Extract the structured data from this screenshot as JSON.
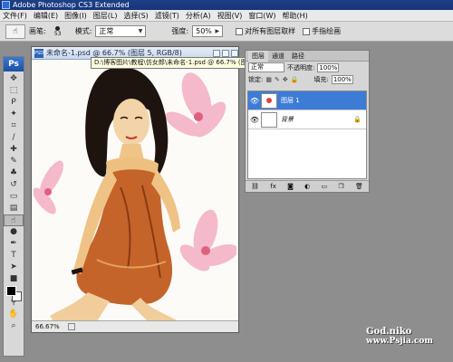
{
  "title_bar": {
    "title": "Adobe Photoshop CS3 Extended"
  },
  "menu": [
    "文件(F)",
    "编辑(E)",
    "图像(I)",
    "图层(L)",
    "选择(S)",
    "滤镜(T)",
    "分析(A)",
    "视图(V)",
    "窗口(W)",
    "帮助(H)"
  ],
  "options": {
    "brush_label": "画笔:",
    "brush_size": "53",
    "mode_label": "模式:",
    "mode_value": "正常",
    "strength_label": "强度:",
    "strength_value": "50%",
    "sample_all_layers": "对所有图层取样",
    "finger_painting": "手指绘画"
  },
  "document": {
    "title": "未命名-1.psd @ 66.7% (图层 5, RGB/8)",
    "zoom": "66.67%",
    "tooltip": "D:\\博客图片\\教程\\仿女郎\\未命名-1.psd @ 66.7% (图层 5, RGB/8)"
  },
  "layers_panel": {
    "tabs": [
      "图层",
      "通道",
      "路径"
    ],
    "blend_mode": "正常",
    "opacity_label": "不透明度:",
    "opacity_value": "100%",
    "lock_label": "锁定:",
    "fill_label": "填充:",
    "fill_value": "100%",
    "layers": [
      {
        "name": "图层 1",
        "active": true
      },
      {
        "name": "背景",
        "active": false
      }
    ]
  },
  "watermark": {
    "line1": "God.niko",
    "line2": "www.Psjia.com"
  },
  "colors": {
    "title_bar": "#17357a",
    "active_layer": "#3d7cd6",
    "foreground": "#000000",
    "background": "#ffffff"
  }
}
